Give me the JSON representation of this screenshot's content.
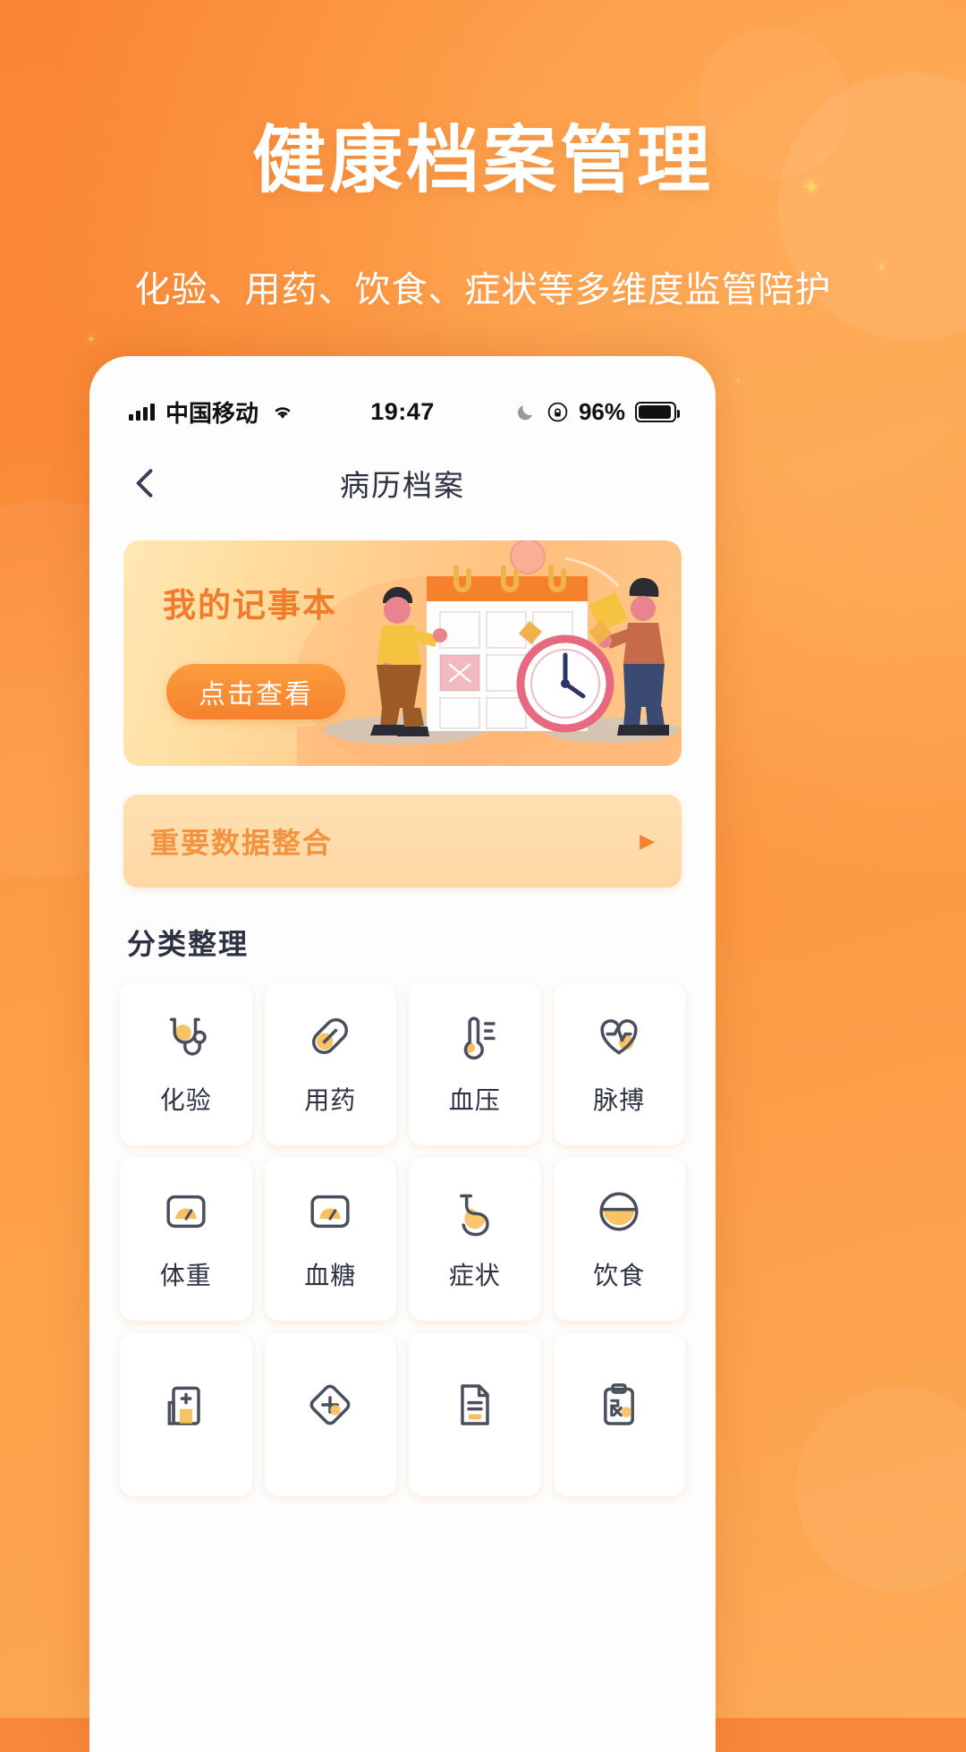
{
  "hero": {
    "title": "健康档案管理",
    "subtitle": "化验、用药、饮食、症状等多维度监管陪护",
    "bg_color": "#fa8634",
    "title_color": "#ffffff"
  },
  "status_bar": {
    "signal_icon": "signal-bars-icon",
    "carrier": "中国移动",
    "wifi_icon": "wifi-icon",
    "time": "19:47",
    "moon_icon": "moon-icon",
    "rotation_lock_icon": "rotation-lock-icon",
    "battery_percent": "96%",
    "battery_icon": "battery-icon"
  },
  "nav": {
    "back_icon": "chevron-left-icon",
    "title": "病历档案"
  },
  "banner": {
    "title": "我的记事本",
    "button_label": "点击查看",
    "illustration": "calendar-people-clock-illustration",
    "accent_color": "#f07c2c"
  },
  "data_bar": {
    "label": "重要数据整合",
    "arrow_icon": "play-arrow-icon",
    "color": "#f29340"
  },
  "section": {
    "title": "分类整理"
  },
  "grid": {
    "items": [
      {
        "label": "化验",
        "icon": "stethoscope-icon"
      },
      {
        "label": "用药",
        "icon": "capsule-pill-icon"
      },
      {
        "label": "血压",
        "icon": "thermometer-icon"
      },
      {
        "label": "脉搏",
        "icon": "heart-pulse-icon"
      },
      {
        "label": "体重",
        "icon": "weight-scale-icon"
      },
      {
        "label": "血糖",
        "icon": "blood-sugar-icon"
      },
      {
        "label": "症状",
        "icon": "stomach-icon"
      },
      {
        "label": "饮食",
        "icon": "bowl-food-icon"
      },
      {
        "label": "",
        "icon": "hospital-icon"
      },
      {
        "label": "",
        "icon": "medical-cross-diamond-icon"
      },
      {
        "label": "",
        "icon": "document-icon"
      },
      {
        "label": "",
        "icon": "prescription-clipboard-icon"
      }
    ]
  }
}
